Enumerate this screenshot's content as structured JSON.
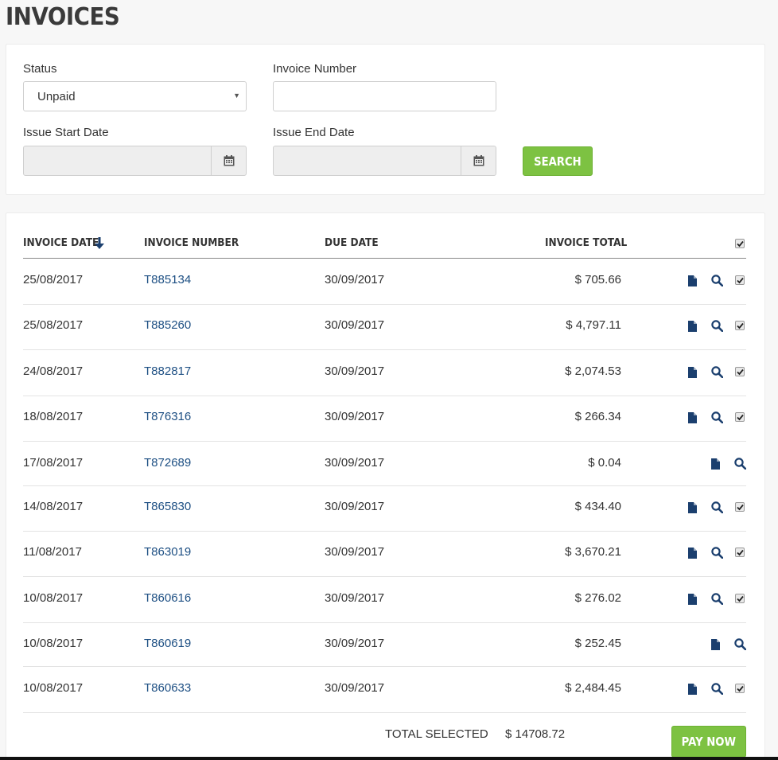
{
  "page": {
    "title": "INVOICES"
  },
  "filters": {
    "status_label": "Status",
    "status_value": "Unpaid",
    "invoice_number_label": "Invoice Number",
    "invoice_number_value": "",
    "issue_start_label": "Issue Start Date",
    "issue_start_value": "",
    "issue_end_label": "Issue End Date",
    "issue_end_value": "",
    "search_label": "SEARCH"
  },
  "table": {
    "columns": {
      "invoice_date": "INVOICE DATE",
      "invoice_number": "INVOICE NUMBER",
      "due_date": "DUE DATE",
      "invoice_total": "INVOICE TOTAL"
    },
    "sort": {
      "column": "invoice_date",
      "direction": "desc"
    },
    "select_all_checked": true,
    "rows": [
      {
        "invoice_date": "25/08/2017",
        "invoice_number": "T885134",
        "due_date": "30/09/2017",
        "invoice_total": "$ 705.66",
        "selectable": true,
        "checked": true
      },
      {
        "invoice_date": "25/08/2017",
        "invoice_number": "T885260",
        "due_date": "30/09/2017",
        "invoice_total": "$ 4,797.11",
        "selectable": true,
        "checked": true
      },
      {
        "invoice_date": "24/08/2017",
        "invoice_number": "T882817",
        "due_date": "30/09/2017",
        "invoice_total": "$ 2,074.53",
        "selectable": true,
        "checked": true
      },
      {
        "invoice_date": "18/08/2017",
        "invoice_number": "T876316",
        "due_date": "30/09/2017",
        "invoice_total": "$ 266.34",
        "selectable": true,
        "checked": true
      },
      {
        "invoice_date": "17/08/2017",
        "invoice_number": "T872689",
        "due_date": "30/09/2017",
        "invoice_total": "$ 0.04",
        "selectable": false,
        "checked": false
      },
      {
        "invoice_date": "14/08/2017",
        "invoice_number": "T865830",
        "due_date": "30/09/2017",
        "invoice_total": "$ 434.40",
        "selectable": true,
        "checked": true
      },
      {
        "invoice_date": "11/08/2017",
        "invoice_number": "T863019",
        "due_date": "30/09/2017",
        "invoice_total": "$ 3,670.21",
        "selectable": true,
        "checked": true
      },
      {
        "invoice_date": "10/08/2017",
        "invoice_number": "T860616",
        "due_date": "30/09/2017",
        "invoice_total": "$ 276.02",
        "selectable": true,
        "checked": true
      },
      {
        "invoice_date": "10/08/2017",
        "invoice_number": "T860619",
        "due_date": "30/09/2017",
        "invoice_total": "$ 252.45",
        "selectable": false,
        "checked": false
      },
      {
        "invoice_date": "10/08/2017",
        "invoice_number": "T860633",
        "due_date": "30/09/2017",
        "invoice_total": "$ 2,484.45",
        "selectable": true,
        "checked": true
      }
    ],
    "row_icons": [
      "document-icon",
      "magnifier-icon"
    ]
  },
  "footer": {
    "total_selected_label": "TOTAL SELECTED",
    "total_selected_value": "$ 14708.72",
    "pay_now_label": "PAY NOW"
  },
  "colors": {
    "accent_green": "#7dc242",
    "link_blue": "#1d4f83",
    "icon_navy": "#1b3f6e"
  }
}
